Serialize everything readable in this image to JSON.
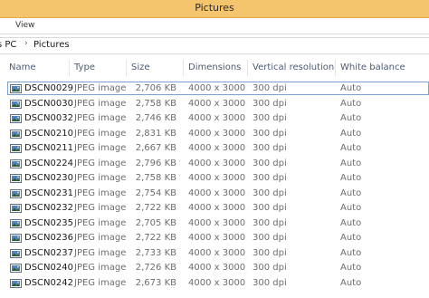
{
  "window": {
    "title": "Pictures"
  },
  "menu": {
    "view_label": "View"
  },
  "breadcrumb": {
    "pc": "s PC",
    "separator": "›",
    "folder": "Pictures"
  },
  "columns": {
    "name": "Name",
    "type": "Type",
    "size": "Size",
    "dimensions": "Dimensions",
    "vertical_resolution": "Vertical resolution",
    "white_balance": "White balance"
  },
  "files": [
    {
      "name": "DSCN0029",
      "type": "JPEG image",
      "size": "2,706 KB",
      "dimensions": "4000 x 3000",
      "resolution": "300 dpi",
      "white_balance": "Auto",
      "selected": true
    },
    {
      "name": "DSCN0030",
      "type": "JPEG image",
      "size": "2,758 KB",
      "dimensions": "4000 x 3000",
      "resolution": "300 dpi",
      "white_balance": "Auto"
    },
    {
      "name": "DSCN0032",
      "type": "JPEG image",
      "size": "2,746 KB",
      "dimensions": "4000 x 3000",
      "resolution": "300 dpi",
      "white_balance": "Auto"
    },
    {
      "name": "DSCN0210",
      "type": "JPEG image",
      "size": "2,831 KB",
      "dimensions": "4000 x 3000",
      "resolution": "300 dpi",
      "white_balance": "Auto"
    },
    {
      "name": "DSCN0211",
      "type": "JPEG image",
      "size": "2,667 KB",
      "dimensions": "4000 x 3000",
      "resolution": "300 dpi",
      "white_balance": "Auto"
    },
    {
      "name": "DSCN0224",
      "type": "JPEG image",
      "size": "2,796 KB",
      "dimensions": "4000 x 3000",
      "resolution": "300 dpi",
      "white_balance": "Auto"
    },
    {
      "name": "DSCN0230",
      "type": "JPEG image",
      "size": "2,758 KB",
      "dimensions": "4000 x 3000",
      "resolution": "300 dpi",
      "white_balance": "Auto"
    },
    {
      "name": "DSCN0231",
      "type": "JPEG image",
      "size": "2,754 KB",
      "dimensions": "4000 x 3000",
      "resolution": "300 dpi",
      "white_balance": "Auto"
    },
    {
      "name": "DSCN0232",
      "type": "JPEG image",
      "size": "2,722 KB",
      "dimensions": "4000 x 3000",
      "resolution": "300 dpi",
      "white_balance": "Auto"
    },
    {
      "name": "DSCN0235",
      "type": "JPEG image",
      "size": "2,705 KB",
      "dimensions": "4000 x 3000",
      "resolution": "300 dpi",
      "white_balance": "Auto"
    },
    {
      "name": "DSCN0236",
      "type": "JPEG image",
      "size": "2,722 KB",
      "dimensions": "4000 x 3000",
      "resolution": "300 dpi",
      "white_balance": "Auto"
    },
    {
      "name": "DSCN0237",
      "type": "JPEG image",
      "size": "2,733 KB",
      "dimensions": "4000 x 3000",
      "resolution": "300 dpi",
      "white_balance": "Auto"
    },
    {
      "name": "DSCN0240",
      "type": "JPEG image",
      "size": "2,726 KB",
      "dimensions": "4000 x 3000",
      "resolution": "300 dpi",
      "white_balance": "Auto"
    },
    {
      "name": "DSCN0242",
      "type": "JPEG image",
      "size": "2,673 KB",
      "dimensions": "4000 x 3000",
      "resolution": "300 dpi",
      "white_balance": "Auto"
    }
  ],
  "colors": {
    "titlebar": "#f5c56d",
    "header_text": "#4d5b73",
    "selection_border": "#7da2ce"
  },
  "icons": {
    "file": "image-file-icon"
  }
}
